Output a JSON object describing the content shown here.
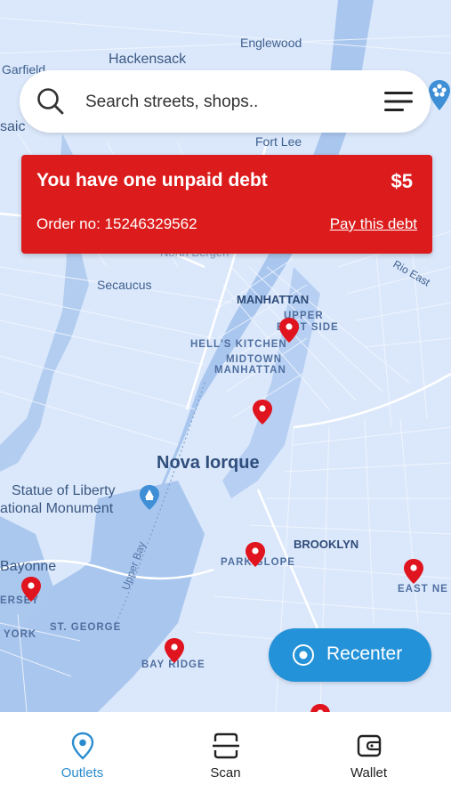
{
  "map": {
    "labels": {
      "englewood": "Englewood",
      "hackensack": "Hackensack",
      "garfield": "Garfield",
      "saic": "saic",
      "fort_lee": "Fort Lee",
      "north_bergen": "North Bergen",
      "secaucus": "Secaucus",
      "rio_east": "Rio East",
      "manhattan": "MANHATTAN",
      "upper": "UPPER",
      "east_side": "EAST SIDE",
      "hells_kitchen": "HELL'S KITCHEN",
      "midtown": "MIDTOWN",
      "midtown_manhattan": "MANHATTAN",
      "nova_iorque": "Nova Iorque",
      "statue_line1": "Statue of Liberty",
      "statue_line2": "ational Monument",
      "bayonne": "Bayonne",
      "brooklyn": "BROOKLYN",
      "park_slope": "PARK SLOPE",
      "upper_bay": "Upper Bay",
      "jersey": "ERSEY",
      "york": "YORK",
      "st_george": "ST. GEORGE",
      "bay_ridge": "BAY RIDGE",
      "east_new": "EAST NE"
    },
    "pin_color": "#e0141e"
  },
  "search": {
    "placeholder": "Search streets, shops.."
  },
  "debt_banner": {
    "title": "You have one unpaid debt",
    "amount": "$5",
    "order_label": "Order no: 15246329562",
    "action_label": "Pay this debt",
    "color": "#dc1c1c"
  },
  "recenter": {
    "label": "Recenter",
    "color": "#2492d8"
  },
  "nav": {
    "items": [
      {
        "label": "Outlets",
        "icon": "location-pin-icon",
        "active": true
      },
      {
        "label": "Scan",
        "icon": "scan-icon",
        "active": false
      },
      {
        "label": "Wallet",
        "icon": "wallet-icon",
        "active": false
      }
    ],
    "active_color": "#2a8ccf"
  }
}
